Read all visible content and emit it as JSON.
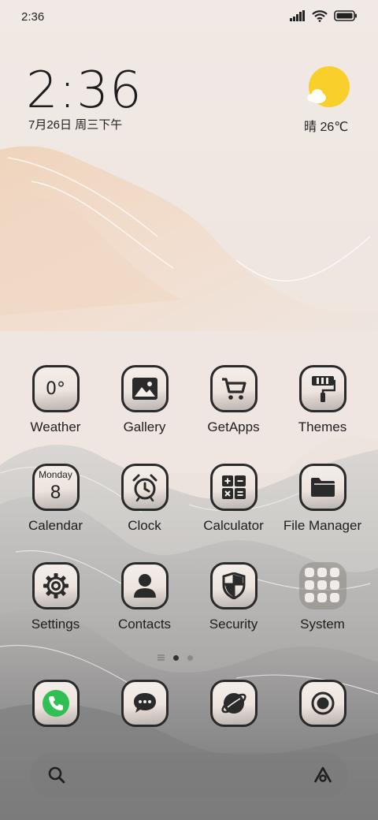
{
  "status_bar": {
    "time": "2:36"
  },
  "lockclock": {
    "time": "2:36",
    "date": "7月26日 周三下午"
  },
  "weather_widget": {
    "condition_temp": "晴 26℃"
  },
  "apps": [
    {
      "label": "Weather",
      "icon": "weather-icon",
      "glyph": "0°"
    },
    {
      "label": "Gallery",
      "icon": "image-icon"
    },
    {
      "label": "GetApps",
      "icon": "cart-icon"
    },
    {
      "label": "Themes",
      "icon": "paint-roller-icon"
    },
    {
      "label": "Calendar",
      "icon": "calendar-icon",
      "weekday": "Monday",
      "day": "8"
    },
    {
      "label": "Clock",
      "icon": "alarm-clock-icon"
    },
    {
      "label": "Calculator",
      "icon": "calculator-icon"
    },
    {
      "label": "File Manager",
      "icon": "folder-icon"
    },
    {
      "label": "Settings",
      "icon": "gear-icon"
    },
    {
      "label": "Contacts",
      "icon": "person-icon"
    },
    {
      "label": "Security",
      "icon": "shield-icon"
    },
    {
      "label": "System",
      "icon": "app-folder-icon"
    }
  ],
  "dock": [
    {
      "icon": "phone-icon"
    },
    {
      "icon": "message-icon"
    },
    {
      "icon": "browser-icon"
    },
    {
      "icon": "camera-icon"
    }
  ],
  "colors": {
    "sun": "#f9cf2c",
    "tile_border": "#2a2a2a",
    "phone_green": "#2fbf55"
  }
}
